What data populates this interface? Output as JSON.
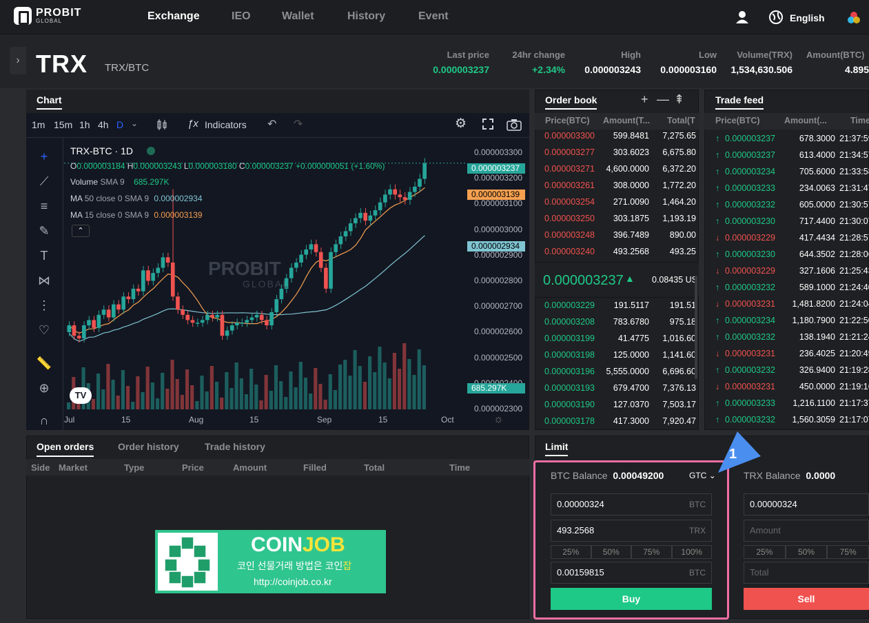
{
  "brand": {
    "name": "PROBIT",
    "sub": "GLOBAL"
  },
  "nav": [
    "Exchange",
    "IEO",
    "Wallet",
    "History",
    "Event"
  ],
  "lang": "English",
  "pair": {
    "coin": "TRX",
    "symbol": "TRX/BTC"
  },
  "stats": [
    {
      "label": "Last price",
      "value": "0.000003237"
    },
    {
      "label": "24hr change",
      "value": "+2.34%"
    },
    {
      "label": "High",
      "value": "0.000003243"
    },
    {
      "label": "Low",
      "value": "0.000003160"
    },
    {
      "label": "Volume(TRX)",
      "value": "1,534,630.506"
    },
    {
      "label": "Amount(BTC)",
      "value": "4.895"
    }
  ],
  "chart": {
    "tab": "Chart",
    "timeframes": [
      "1m",
      "15m",
      "1h",
      "4h",
      "D"
    ],
    "indicators": "Indicators",
    "title": "TRX-BTC · 1D",
    "ohlc": {
      "o": "0.000003184",
      "h": "0.000003243",
      "l": "0.000003180",
      "c": "0.000003237",
      "chg": "+0.000000051 (+1.60%)"
    },
    "volume_label": "Volume",
    "volume_sma": "SMA 9",
    "volume_val": "685.297K",
    "ma50_label": "MA",
    "ma50_params": "50 close 0 SMA 9",
    "ma50_val": "0.000002934",
    "ma15_label": "MA",
    "ma15_params": "15 close 0 SMA 9",
    "ma15_val": "0.000003139",
    "yticks": [
      "0.000003300",
      "0.000003200",
      "0.000003100",
      "0.000003000",
      "0.000002900",
      "0.000002800",
      "0.000002700",
      "0.000002600",
      "0.000002500",
      "0.000002400",
      "0.000002300"
    ],
    "tags": {
      "price": "0.000003237",
      "ma15": "0.000003139",
      "ma50": "0.000002934",
      "vol": "685.297K"
    },
    "xlabels": [
      "Jul",
      "15",
      "Aug",
      "15",
      "Sep",
      "15",
      "Oct"
    ],
    "watermark": "PROBIT",
    "watermark_sub": "GLOBAL",
    "tv_logo": "TV"
  },
  "chart_data": {
    "type": "candlestick",
    "title": "TRX-BTC · 1D",
    "xlabels": [
      "Jul",
      "15",
      "Aug",
      "15",
      "Sep",
      "15",
      "Oct"
    ],
    "ylim": [
      2.3e-06,
      3.3e-06
    ],
    "closes": [
      2.62e-06,
      2.58e-06,
      2.57e-06,
      2.62e-06,
      2.64e-06,
      2.61e-06,
      2.66e-06,
      2.68e-06,
      2.65e-06,
      2.7e-06,
      2.68e-06,
      2.73e-06,
      2.72e-06,
      2.76e-06,
      2.75e-06,
      2.83e-06,
      2.79e-06,
      2.82e-06,
      2.84e-06,
      2.88e-06,
      2.86e-06,
      2.73e-06,
      2.68e-06,
      2.66e-06,
      2.64e-06,
      2.63e-06,
      2.63e-06,
      2.64e-06,
      2.66e-06,
      2.65e-06,
      2.66e-06,
      2.58e-06,
      2.6e-06,
      2.62e-06,
      2.63e-06,
      2.63e-06,
      2.64e-06,
      2.65e-06,
      2.66e-06,
      2.64e-06,
      2.62e-06,
      2.67e-06,
      2.72e-06,
      2.76e-06,
      2.8e-06,
      2.84e-06,
      2.86e-06,
      2.89e-06,
      2.91e-06,
      2.93e-06,
      2.9e-06,
      2.84e-06,
      2.76e-06,
      2.9e-06,
      2.93e-06,
      2.96e-06,
      2.98e-06,
      3.01e-06,
      3.03e-06,
      3.05e-06,
      3.02e-06,
      3.04e-06,
      3.06e-06,
      3.09e-06,
      3.12e-06,
      3.14e-06,
      3.12e-06,
      3.11e-06,
      3.1e-06,
      3.13e-06,
      3.15e-06,
      3.18e-06,
      3.24e-06
    ],
    "volume_last": "685.297K"
  },
  "orderbook": {
    "tab": "Order book",
    "headers": [
      "Price(BTC)",
      "Amount(T...",
      "Total(T"
    ],
    "asks": [
      [
        "0.000003300",
        "599.8481",
        "7,275.65"
      ],
      [
        "0.000003277",
        "303.6023",
        "6,675.80"
      ],
      [
        "0.000003271",
        "4,600.0000",
        "6,372.20"
      ],
      [
        "0.000003261",
        "308.0000",
        "1,772.20"
      ],
      [
        "0.000003254",
        "271.0090",
        "1,464.20"
      ],
      [
        "0.000003250",
        "303.1875",
        "1,193.19"
      ],
      [
        "0.000003248",
        "396.7489",
        "890.00"
      ],
      [
        "0.000003240",
        "493.2568",
        "493.25"
      ]
    ],
    "mid": "0.000003237",
    "mid_usd": "0.08435 US",
    "bids": [
      [
        "0.000003229",
        "191.5117",
        "191.51"
      ],
      [
        "0.000003208",
        "783.6780",
        "975.18"
      ],
      [
        "0.000003199",
        "41.4775",
        "1,016.60"
      ],
      [
        "0.000003198",
        "125.0000",
        "1,141.60"
      ],
      [
        "0.000003196",
        "5,555.0000",
        "6,696.60"
      ],
      [
        "0.000003193",
        "679.4700",
        "7,376.13"
      ],
      [
        "0.000003190",
        "127.0370",
        "7,503.17"
      ],
      [
        "0.000003178",
        "417.3000",
        "7,920.47"
      ]
    ]
  },
  "tradefeed": {
    "tab": "Trade feed",
    "headers": [
      "Price(BTC)",
      "Amount(...",
      "Time"
    ],
    "rows": [
      [
        "0.000003237",
        "678.3000",
        "21:37:59",
        "up"
      ],
      [
        "0.000003237",
        "613.4000",
        "21:34:57",
        "up"
      ],
      [
        "0.000003234",
        "705.6000",
        "21:33:58",
        "up"
      ],
      [
        "0.000003233",
        "234.0063",
        "21:31:47",
        "up"
      ],
      [
        "0.000003232",
        "605.0000",
        "21:30:57",
        "up"
      ],
      [
        "0.000003230",
        "717.4400",
        "21:30:07",
        "up"
      ],
      [
        "0.000003229",
        "417.4434",
        "21:28:57",
        "down"
      ],
      [
        "0.000003230",
        "644.3502",
        "21:28:06",
        "up"
      ],
      [
        "0.000003229",
        "327.1606",
        "21:25:43",
        "down"
      ],
      [
        "0.000003232",
        "589.1000",
        "21:24:40",
        "up"
      ],
      [
        "0.000003231",
        "1,481.8200",
        "21:24:04",
        "down"
      ],
      [
        "0.000003234",
        "1,180.7900",
        "21:22:50",
        "up"
      ],
      [
        "0.000003232",
        "138.1940",
        "21:21:24",
        "up"
      ],
      [
        "0.000003231",
        "236.4025",
        "21:20:49",
        "down"
      ],
      [
        "0.000003232",
        "326.9400",
        "21:19:28",
        "up"
      ],
      [
        "0.000003231",
        "450.0000",
        "21:19:16",
        "down"
      ],
      [
        "0.000003233",
        "1,216.1100",
        "21:17:37",
        "up"
      ],
      [
        "0.000003232",
        "1,560.3059",
        "21:17:07",
        "up"
      ]
    ]
  },
  "orders": {
    "tabs": [
      "Open orders",
      "Order history",
      "Trade history"
    ],
    "headers": [
      "Side",
      "Market",
      "Type",
      "Price",
      "Amount",
      "Filled",
      "Total",
      "Time"
    ]
  },
  "ad": {
    "title1": "COIN",
    "title2": "JOB",
    "line": "코인 선물거래 방법은 코인",
    "line_hl": "잡",
    "url": "http://coinjob.co.kr"
  },
  "limit": {
    "tab": "Limit",
    "buy": {
      "balance_label": "BTC Balance",
      "balance": "0.00049200",
      "tif": "GTC",
      "price": "0.00000324",
      "price_unit": "BTC",
      "amount": "493.2568",
      "amount_unit": "TRX",
      "pcts": [
        "25%",
        "50%",
        "75%",
        "100%"
      ],
      "total": "0.00159815",
      "total_unit": "BTC",
      "button": "Buy"
    },
    "sell": {
      "balance_label": "TRX Balance",
      "balance": "0.0000",
      "price": "0.00000324",
      "amount_ph": "Amount",
      "pcts": [
        "25%",
        "50%",
        "75%"
      ],
      "total_ph": "Total",
      "button": "Sell"
    },
    "callout": "1"
  }
}
